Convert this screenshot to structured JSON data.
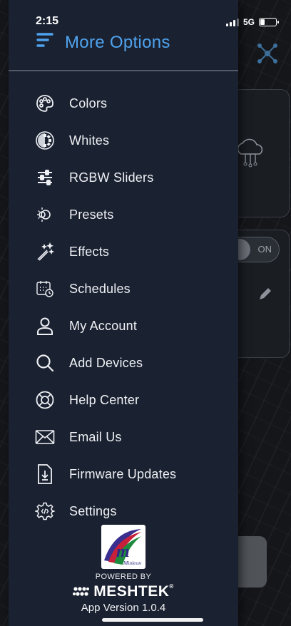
{
  "status_bar": {
    "time": "2:15",
    "network": "5G",
    "signal_bars": 4,
    "signal_active": 3,
    "battery_level": 0.3
  },
  "drawer": {
    "title": "More Options",
    "title_color": "#4fa3ee",
    "menu_icon": "hamburger-menu-icon",
    "items": [
      {
        "label": "Colors",
        "icon": "palette-icon"
      },
      {
        "label": "Whites",
        "icon": "white-temperature-icon"
      },
      {
        "label": "RGBW Sliders",
        "icon": "sliders-icon"
      },
      {
        "label": "Presets",
        "icon": "presets-bulb-icon"
      },
      {
        "label": "Effects",
        "icon": "magic-wand-icon"
      },
      {
        "label": "Schedules",
        "icon": "calendar-clock-icon"
      },
      {
        "label": "My Account",
        "icon": "user-icon"
      },
      {
        "label": "Add Devices",
        "icon": "search-icon"
      },
      {
        "label": "Help Center",
        "icon": "lifebuoy-icon"
      },
      {
        "label": "Email Us",
        "icon": "envelope-icon"
      },
      {
        "label": "Firmware Updates",
        "icon": "firmware-download-icon"
      },
      {
        "label": "Settings",
        "icon": "gear-icon"
      }
    ],
    "footer": {
      "logo_text": "Minleon",
      "powered_by": "POWERED BY",
      "brand": "MESHTEK",
      "brand_mark": "®",
      "app_version": "App Version 1.0.4"
    }
  },
  "background": {
    "toggle_label": "ON"
  }
}
